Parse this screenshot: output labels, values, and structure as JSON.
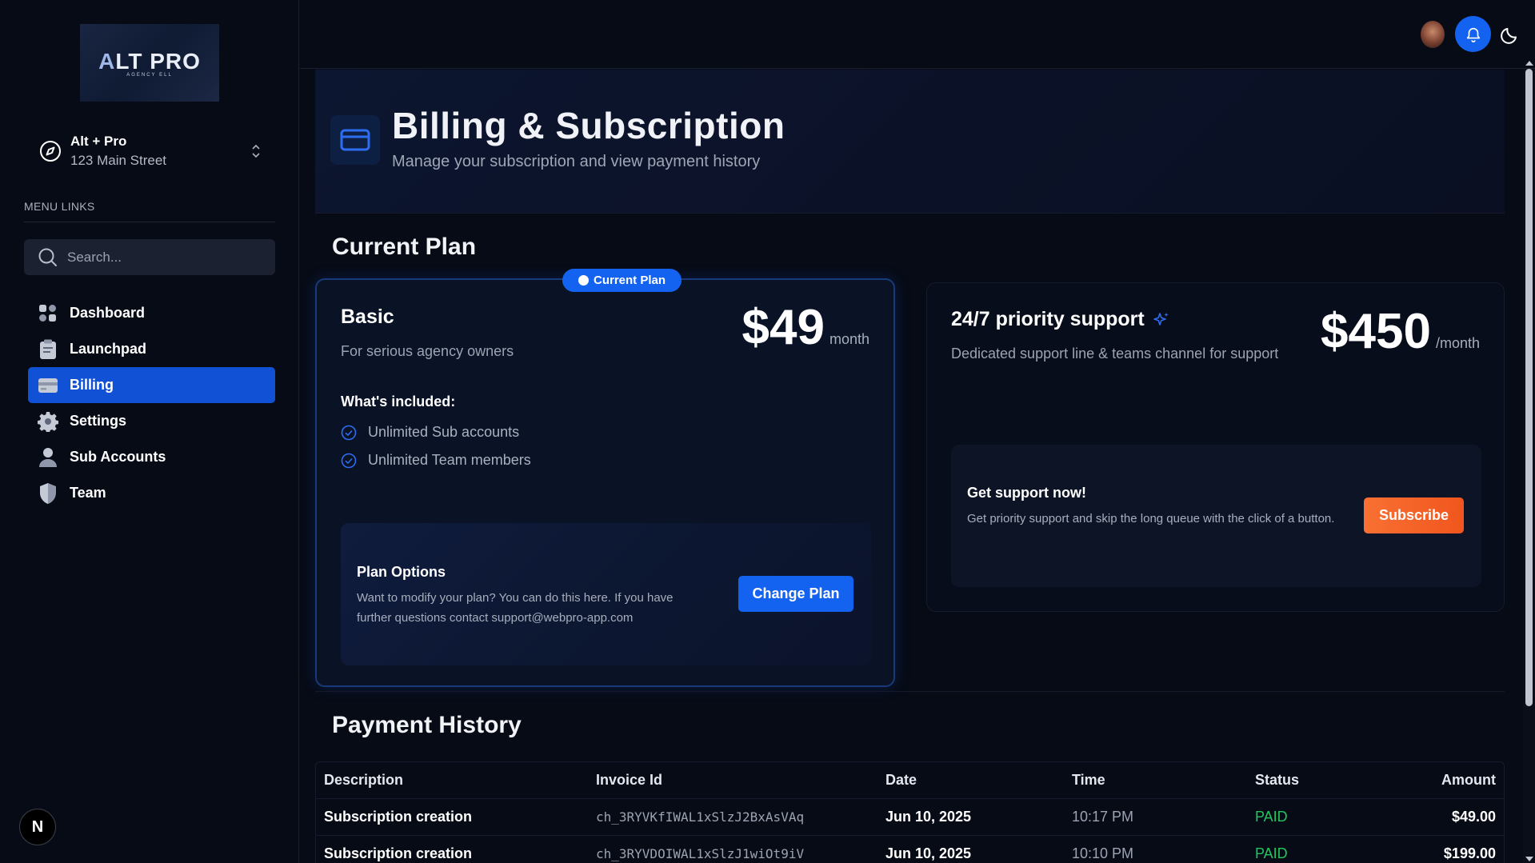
{
  "logo": {
    "main_a": "A",
    "main_rest": "LT PRO",
    "sub": "AGENCY ELL"
  },
  "account": {
    "name": "Alt + Pro",
    "address": "123 Main Street"
  },
  "sidebar": {
    "menu_label": "MENU LINKS",
    "search_placeholder": "Search...",
    "items": [
      {
        "label": "Dashboard",
        "icon": "grid-icon",
        "active": false
      },
      {
        "label": "Launchpad",
        "icon": "clipboard-icon",
        "active": false
      },
      {
        "label": "Billing",
        "icon": "credit-card-icon",
        "active": true
      },
      {
        "label": "Settings",
        "icon": "gear-icon",
        "active": false
      },
      {
        "label": "Sub Accounts",
        "icon": "person-icon",
        "active": false
      },
      {
        "label": "Team",
        "icon": "shield-icon",
        "active": false
      }
    ],
    "bottom_badge": "N"
  },
  "header": {
    "title": "Billing & Subscription",
    "subtitle": "Manage your subscription and view payment history"
  },
  "current_plan": {
    "section_title": "Current Plan",
    "badge": "Current Plan",
    "name": "Basic",
    "description": "For serious agency owners",
    "price": "$49",
    "period": "month",
    "included_title": "What's included:",
    "features": [
      "Unlimited Sub accounts",
      "Unlimited Team members"
    ],
    "options_title": "Plan Options",
    "options_desc": "Want to modify your plan? You can do this here. If you have further questions contact support@webpro-app.com",
    "change_button": "Change Plan"
  },
  "support": {
    "title": "24/7 priority support",
    "description": "Dedicated support line & teams channel for support",
    "price": "$450",
    "period": "/month",
    "box_title": "Get support now!",
    "box_desc": "Get priority support and skip the long queue with the click of a button.",
    "subscribe_button": "Subscribe"
  },
  "payment_history": {
    "section_title": "Payment History",
    "columns": [
      "Description",
      "Invoice Id",
      "Date",
      "Time",
      "Status",
      "Amount"
    ],
    "rows": [
      [
        "Subscription creation",
        "ch_3RYVKfIWAL1xSlzJ2BxAsVAq",
        "Jun 10, 2025",
        "10:17 PM",
        "PAID",
        "$49.00"
      ],
      [
        "Subscription creation",
        "ch_3RYVDOIWAL1xSlzJ1wiOt9iV",
        "Jun 10, 2025",
        "10:10 PM",
        "PAID",
        "$199.00"
      ]
    ]
  },
  "colors": {
    "accent": "#1463f0",
    "paid": "#22c55e",
    "subscribe": "#f97033",
    "background": "#070b16"
  }
}
